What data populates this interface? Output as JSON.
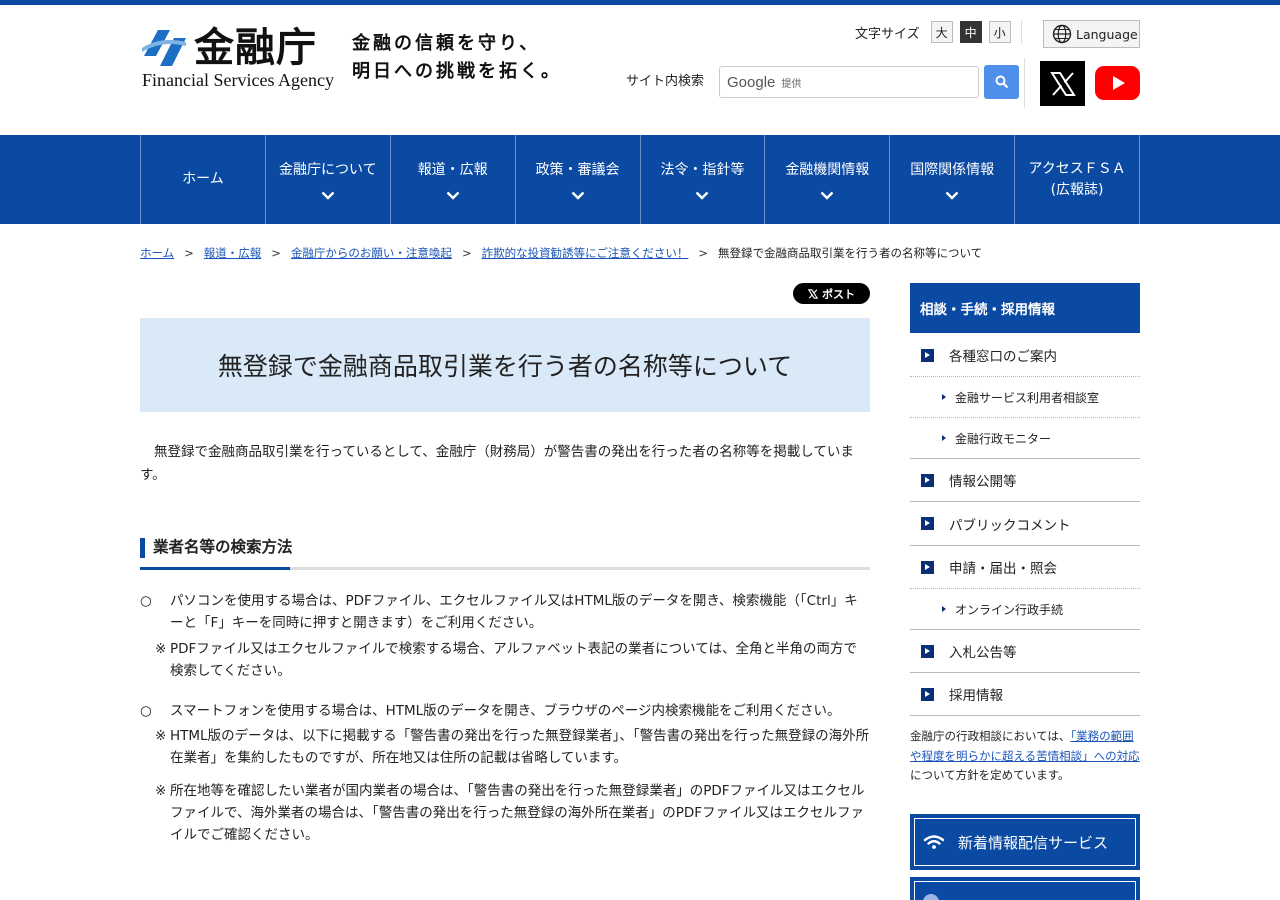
{
  "header": {
    "logo_jp": "金融庁",
    "logo_en": "Financial Services Agency",
    "tagline_line1": "金融の信頼を守り、",
    "tagline_line2": "明日への挑戦を拓く。",
    "font_size_label": "文字サイズ",
    "font_sizes": [
      "大",
      "中",
      "小"
    ],
    "font_size_selected": "中",
    "language_label": "Language",
    "search_label": "サイト内検索",
    "search_brand": "Google",
    "search_provided": "提供",
    "icons": [
      "globe-icon",
      "search-icon",
      "x-logo-icon",
      "youtube-icon"
    ]
  },
  "nav": {
    "items": [
      {
        "label": "ホーム",
        "dropdown": false
      },
      {
        "label": "金融庁について",
        "dropdown": true
      },
      {
        "label": "報道・広報",
        "dropdown": true
      },
      {
        "label": "政策・審議会",
        "dropdown": true
      },
      {
        "label": "法令・指針等",
        "dropdown": true
      },
      {
        "label": "金融機関情報",
        "dropdown": true
      },
      {
        "label": "国際関係情報",
        "dropdown": true
      },
      {
        "label": "アクセスＦＳＡ\n(広報誌)",
        "dropdown": false
      }
    ]
  },
  "breadcrumb": {
    "items": [
      "ホーム",
      "報道・広報",
      "金融庁からのお願い・注意喚起",
      "詐欺的な投資勧誘等にご注意ください！"
    ],
    "current": "無登録で金融商品取引業を行う者の名称等について",
    "separator": ">"
  },
  "share": {
    "post_label": "ポスト"
  },
  "main": {
    "title": "無登録で金融商品取引業を行う者の名称等について",
    "intro": "無登録で金融商品取引業を行っているとして、金融庁（財務局）が警告書の発出を行った者の名称等を掲載しています。",
    "section_heading": "業者名等の検索方法",
    "bullet_mark": "○",
    "note_mark": "※",
    "p1": "パソコンを使用する場合は、PDFファイル、エクセルファイル又はHTML版のデータを開き、検索機能（「Ctrl」キーと「F」キーを同時に押すと開きます）をご利用ください。",
    "p1_note": "PDFファイル又はエクセルファイルで検索する場合、アルファベット表記の業者については、全角と半角の両方で検索してください。",
    "p2": "スマートフォンを使用する場合は、HTML版のデータを開き、ブラウザのページ内検索機能をご利用ください。",
    "p2_note1": "HTML版のデータは、以下に掲載する「警告書の発出を行った無登録業者」、「警告書の発出を行った無登録の海外所在業者」を集約したものですが、所在地又は住所の記載は省略しています。",
    "p2_note2": "所在地等を確認したい業者が国内業者の場合は、「警告書の発出を行った無登録業者」のPDFファイル又はエクセルファイルで、海外業者の場合は、「警告書の発出を行った無登録の海外所在業者」のPDFファイル又はエクセルファイルでご確認ください。"
  },
  "sidebar": {
    "heading": "相談・手続・採用情報",
    "items": [
      "各種窓口のご案内",
      "金融サービス利用者相談室",
      "金融行政モニター",
      "情報公開等",
      "パブリックコメント",
      "申請・届出・照会",
      "オンライン行政手続",
      "入札公告等",
      "採用情報"
    ],
    "note_before": "金融庁の行政相談においては、",
    "note_link": "「業務の範囲や程度を明らかに超える苦情相談」への対応",
    "note_after": "について方針を定めています。",
    "rss_label": "新着情報配信サービス"
  },
  "colors": {
    "brand_blue": "#0b4aa2",
    "title_bg": "#d9e9f7",
    "link": "#1a55b8"
  }
}
